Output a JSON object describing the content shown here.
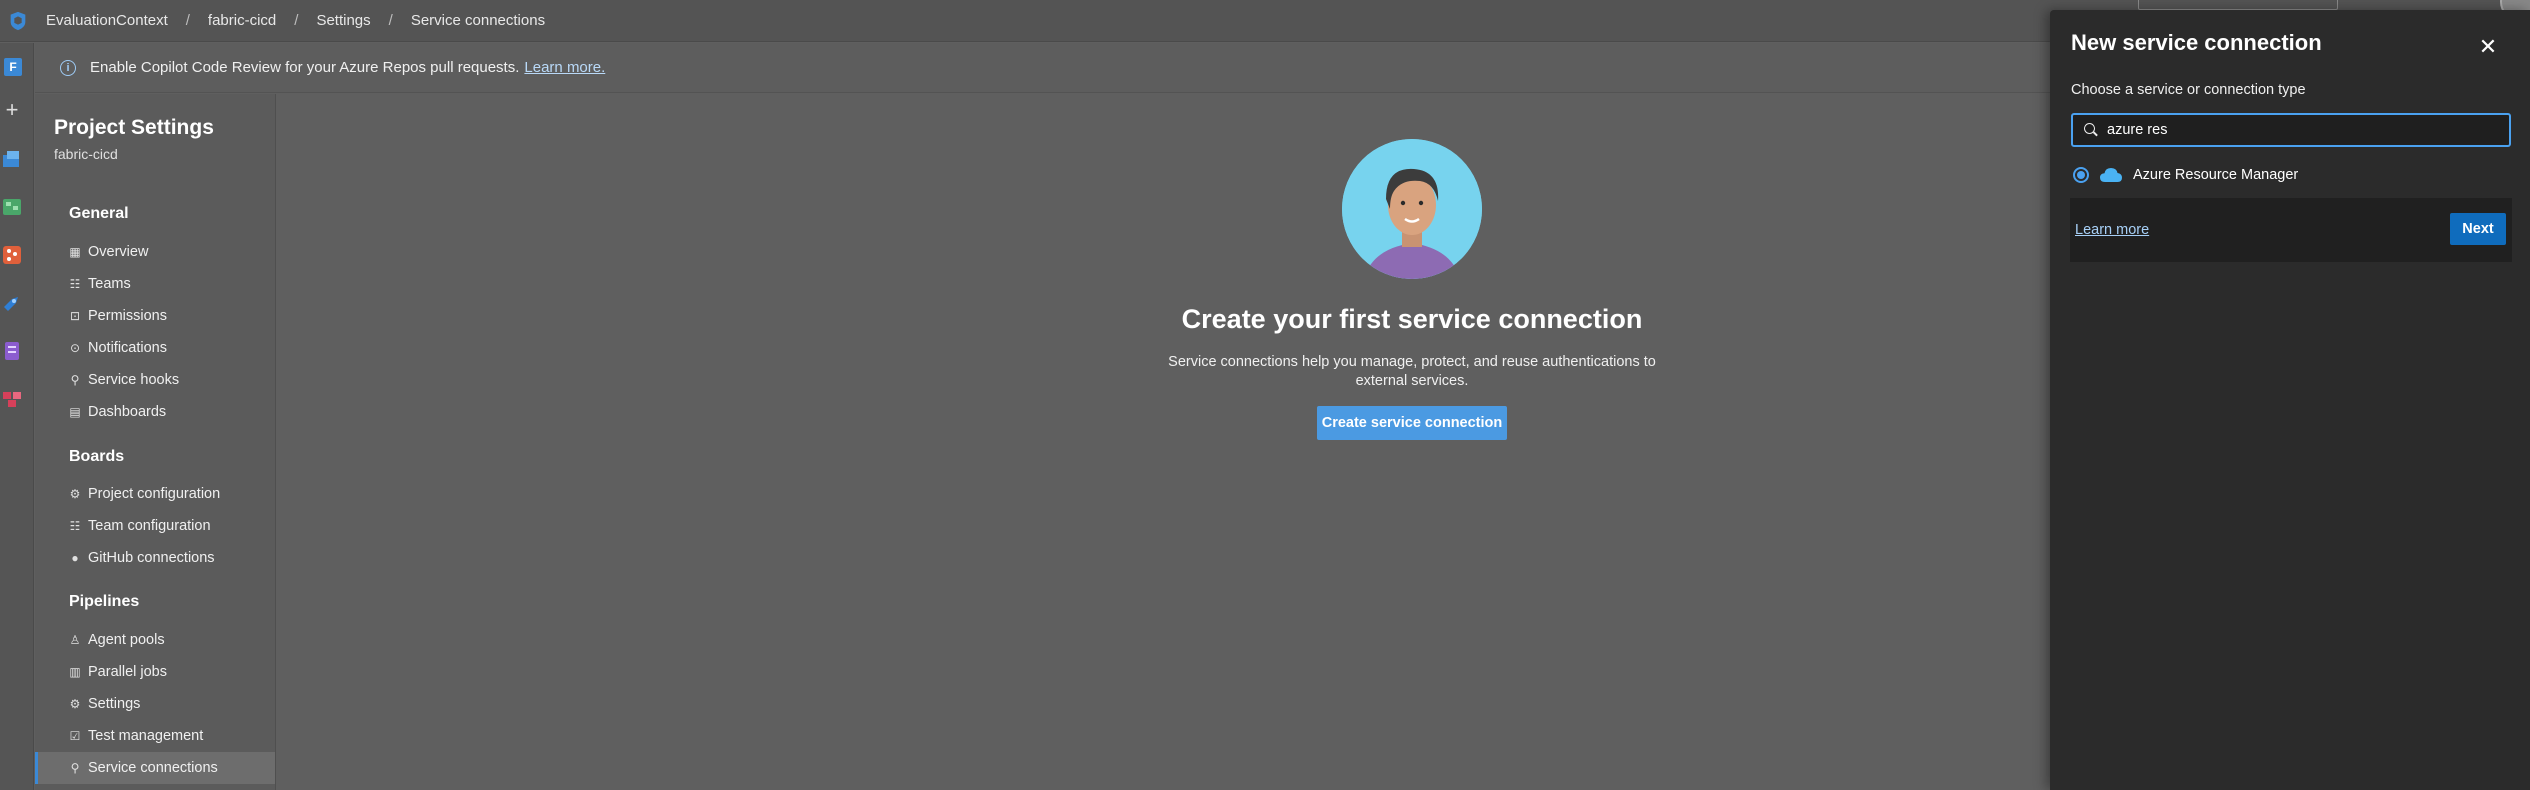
{
  "breadcrumb": {
    "org": "EvaluationContext",
    "project": "fabric-cicd",
    "section": "Settings",
    "page": "Service connections"
  },
  "rail": {
    "project_initial": "F",
    "add_symbol": "+"
  },
  "banner": {
    "icon": "info-icon",
    "text": "Enable Copilot Code Review for your Azure Repos pull requests.",
    "link": "Learn more."
  },
  "settings_nav": {
    "title": "Project Settings",
    "subtitle": "fabric-cicd",
    "sections": [
      {
        "title": "General",
        "items": [
          {
            "label": "Overview",
            "icon": "overview-icon"
          },
          {
            "label": "Teams",
            "icon": "teams-icon"
          },
          {
            "label": "Permissions",
            "icon": "lock-icon"
          },
          {
            "label": "Notifications",
            "icon": "notification-icon"
          },
          {
            "label": "Service hooks",
            "icon": "hook-icon"
          },
          {
            "label": "Dashboards",
            "icon": "dashboard-icon"
          }
        ]
      },
      {
        "title": "Boards",
        "items": [
          {
            "label": "Project configuration",
            "icon": "config-icon"
          },
          {
            "label": "Team configuration",
            "icon": "team-config-icon"
          },
          {
            "label": "GitHub connections",
            "icon": "github-icon"
          }
        ]
      },
      {
        "title": "Pipelines",
        "items": [
          {
            "label": "Agent pools",
            "icon": "agent-icon"
          },
          {
            "label": "Parallel jobs",
            "icon": "parallel-icon"
          },
          {
            "label": "Settings",
            "icon": "gear-icon"
          },
          {
            "label": "Test management",
            "icon": "test-icon"
          },
          {
            "label": "Service connections",
            "icon": "plug-icon",
            "selected": true
          }
        ]
      }
    ]
  },
  "empty_state": {
    "title": "Create your first service connection",
    "description": "Service connections help you manage, protect, and reuse authentications to external services.",
    "button": "Create service connection"
  },
  "panel": {
    "title": "New service connection",
    "label": "Choose a service or connection type",
    "search_value": "azure res",
    "result": "Azure Resource Manager",
    "learn_more": "Learn more",
    "next": "Next"
  },
  "colors": {
    "accent": "#0f6cbd",
    "link": "#a7d0f7",
    "avatar_bg": "#77d3ee"
  }
}
